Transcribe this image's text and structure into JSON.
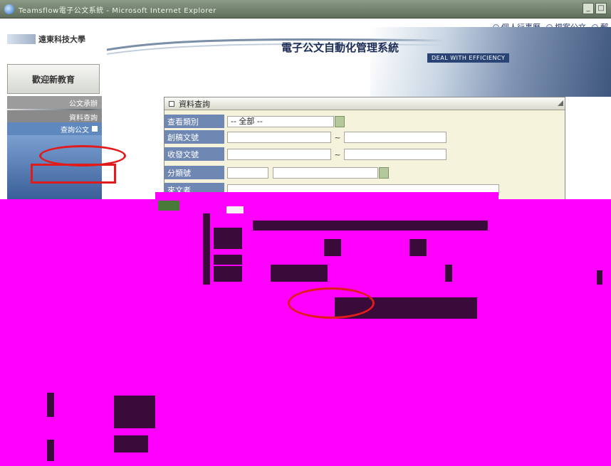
{
  "window": {
    "title": "Teamsflow電子公文系統 - Microsoft Internet Explorer",
    "controls": [
      "_",
      "□"
    ]
  },
  "header": {
    "school": "遠東科技大學",
    "links": [
      "個人行事曆",
      "檔案公文",
      "郵"
    ],
    "system_title": "電子公文自動化管理系統",
    "slogan": "DEAL WITH EFFICIENCY"
  },
  "sidebar": {
    "entrance": "歡迎新教育",
    "items": [
      {
        "label": "公文承辦"
      },
      {
        "label": "資料查詢"
      },
      {
        "label": "查詢公文"
      }
    ]
  },
  "query": {
    "title": "資料查詢",
    "rows": [
      {
        "label": "查看類別",
        "type": "select",
        "value": "-- 全部 --"
      },
      {
        "label": "創稿文號",
        "type": "range"
      },
      {
        "label": "收發文號",
        "type": "range"
      },
      {
        "label": "分類號",
        "type": "select2"
      },
      {
        "label": "來文者",
        "type": "text"
      }
    ]
  },
  "colors": {
    "annotation": "#e11b1b",
    "redaction": "#ff00ff",
    "label_bg": "#6f87b3",
    "panel_bg": "#f6f3dd"
  }
}
